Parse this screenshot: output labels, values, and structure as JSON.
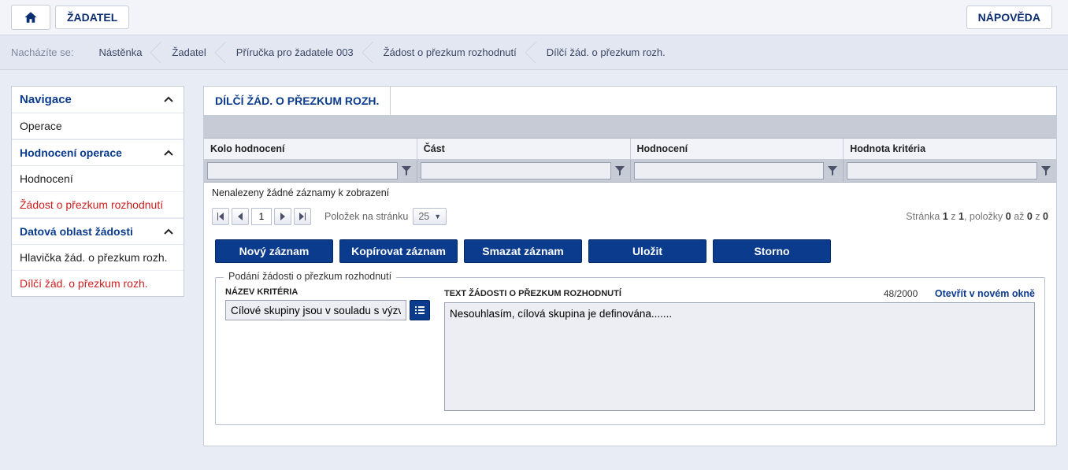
{
  "topbar": {
    "home_icon": "home-icon",
    "applicant_label": "ŽADATEL",
    "help_label": "NÁPOVĚDA"
  },
  "breadcrumb": {
    "label": "Nacházíte se:",
    "items": [
      "Nástěnka",
      "Žadatel",
      "Příručka pro žadatele 003",
      "Žádost o přezkum rozhodnutí",
      "Dílčí žád. o přezkum rozh."
    ]
  },
  "sidebar": {
    "nav_header": "Navigace",
    "nav_items": [
      "Operace"
    ],
    "eval_header": "Hodnocení operace",
    "eval_items": [
      {
        "label": "Hodnocení",
        "red": false
      },
      {
        "label": "Žádost o přezkum rozhodnutí",
        "red": true
      }
    ],
    "data_header": "Datová oblast žádosti",
    "data_items": [
      {
        "label": "Hlavička žád. o přezkum rozh.",
        "red": false
      },
      {
        "label": "Dílčí žád. o přezkum rozh.",
        "red": true
      }
    ]
  },
  "main": {
    "title": "DÍLČÍ ŽÁD. O PŘEZKUM ROZH.",
    "grid": {
      "columns": [
        "Kolo hodnocení",
        "Část",
        "Hodnocení",
        "Hodnota kritéria"
      ],
      "no_records": "Nenalezeny žádné záznamy k zobrazení"
    },
    "pager": {
      "page": "1",
      "per_page_label": "Položek na stránku",
      "per_page": "25",
      "info_prefix": "Stránka ",
      "info_page": "1",
      "info_of": " z ",
      "info_total_pages": "1",
      "info_items": ", položky ",
      "info_from": "0",
      "info_to_label": " až ",
      "info_to": "0",
      "info_z": " z ",
      "info_count": "0"
    },
    "actions": {
      "new": "Nový záznam",
      "copy": "Kopírovat záznam",
      "delete": "Smazat záznam",
      "save": "Uložit",
      "cancel": "Storno"
    },
    "form": {
      "legend": "Podání žádosti o přezkum rozhodnutí",
      "criterion_label": "NÁZEV KRITÉRIA",
      "criterion_value": "Cílové skupiny jsou v souladu s výzvou",
      "text_label": "TEXT ŽÁDOSTI O PŘEZKUM ROZHODNUTÍ",
      "text_value": "Nesouhlasím, cílová skupina je definována.......",
      "char_count": "48/2000",
      "open_link": "Otevřít v novém okně"
    }
  }
}
